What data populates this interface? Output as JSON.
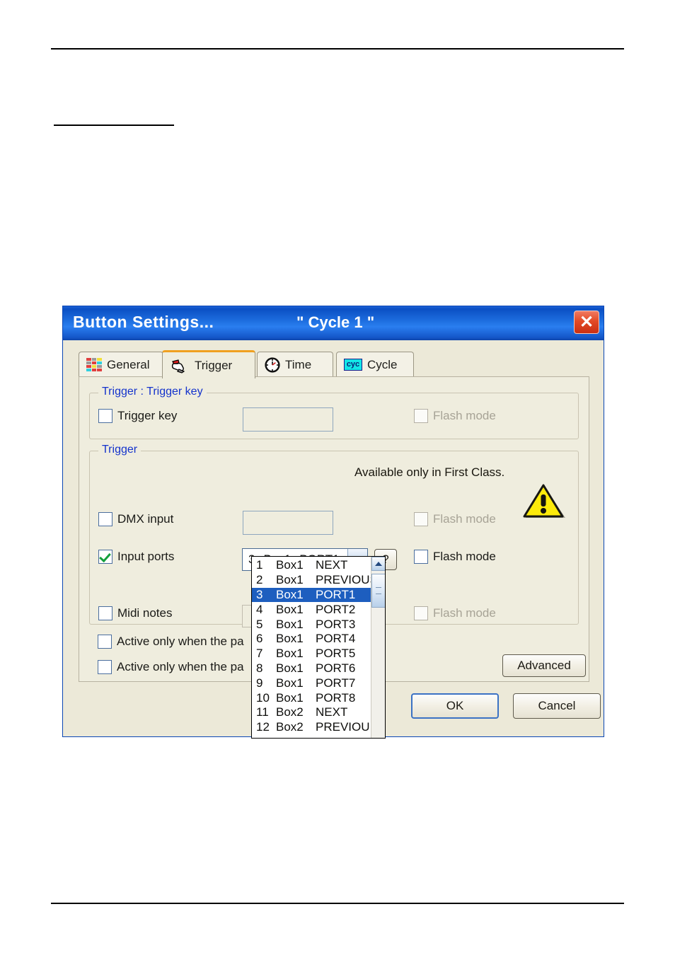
{
  "window": {
    "title": "Button  Settings...",
    "subtitle": "\" Cycle 1 \"",
    "close_label": "✕",
    "titlebar_color": "#1e6fe0",
    "body_color": "#ece9d8"
  },
  "tabs": [
    {
      "label": "General",
      "icon": "color-grid-icon",
      "active": false
    },
    {
      "label": "Trigger",
      "icon": "hand-click-icon",
      "active": true
    },
    {
      "label": "Time",
      "icon": "clock-icon",
      "active": false
    },
    {
      "label": "Cycle",
      "icon": "cyc-badge-icon",
      "active": false
    }
  ],
  "cycle_badge_text": "cyc",
  "groups": {
    "trigger_key": {
      "legend": "Trigger : Trigger key",
      "checkbox_label": "Trigger key",
      "checkbox_checked": false,
      "textbox_value": "",
      "flash_label": "Flash mode",
      "flash_checked": false,
      "flash_enabled": false
    },
    "trigger": {
      "legend": "Trigger",
      "note": "Available only in First Class.",
      "warning_icon": "warning-triangle-icon",
      "dmx": {
        "label": "DMX input",
        "checked": false,
        "textbox_value": "",
        "flash_label": "Flash mode",
        "flash_checked": false,
        "flash_enabled": false
      },
      "input_ports": {
        "label": "Input ports",
        "checked": true,
        "selected_value": {
          "index": "3",
          "box": "Box1",
          "port": "PORT1"
        },
        "help_label": "?",
        "flash_label": "Flash mode",
        "flash_checked": false,
        "flash_enabled": true
      },
      "midi": {
        "label": "Midi notes",
        "checked": false,
        "flash_label": "Flash mode",
        "flash_checked": false,
        "flash_enabled": false
      }
    }
  },
  "page_options": [
    {
      "label": "Active only when the pa",
      "checked": false
    },
    {
      "label": "Active only when the pa",
      "checked": false
    }
  ],
  "dropdown": {
    "open": true,
    "selected_index": 2,
    "items": [
      {
        "n": "1",
        "box": "Box1",
        "port": "NEXT"
      },
      {
        "n": "2",
        "box": "Box1",
        "port": "PREVIOUS"
      },
      {
        "n": "3",
        "box": "Box1",
        "port": "PORT1"
      },
      {
        "n": "4",
        "box": "Box1",
        "port": "PORT2"
      },
      {
        "n": "5",
        "box": "Box1",
        "port": "PORT3"
      },
      {
        "n": "6",
        "box": "Box1",
        "port": "PORT4"
      },
      {
        "n": "7",
        "box": "Box1",
        "port": "PORT5"
      },
      {
        "n": "8",
        "box": "Box1",
        "port": "PORT6"
      },
      {
        "n": "9",
        "box": "Box1",
        "port": "PORT7"
      },
      {
        "n": "10",
        "box": "Box1",
        "port": "PORT8"
      },
      {
        "n": "11",
        "box": "Box2",
        "port": "NEXT"
      },
      {
        "n": "12",
        "box": "Box2",
        "port": "PREVIOU"
      }
    ]
  },
  "buttons": {
    "advanced": "Advanced",
    "ok": "OK",
    "cancel": "Cancel"
  }
}
